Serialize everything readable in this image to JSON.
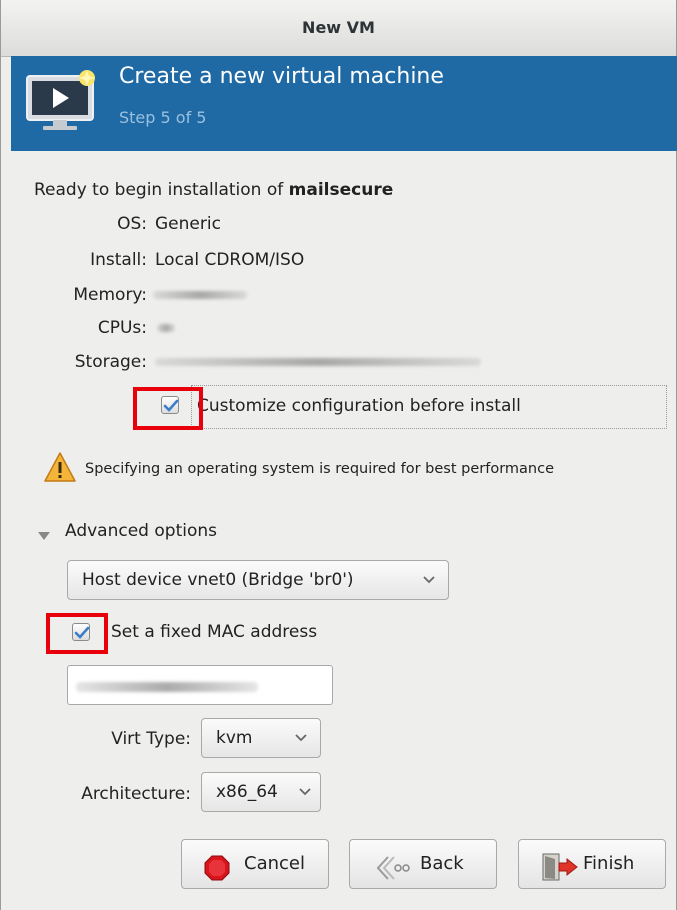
{
  "window": {
    "title": "New VM"
  },
  "header": {
    "title": "Create a new virtual machine",
    "step": "Step 5 of 5"
  },
  "summary": {
    "intro": "Ready to begin installation of ",
    "vm_name": "mailsecure",
    "os_label": "OS:",
    "os_value": "Generic",
    "install_label": "Install:",
    "install_value": "Local CDROM/ISO",
    "memory_label": "Memory:",
    "cpus_label": "CPUs:",
    "storage_label": "Storage:"
  },
  "customize": {
    "label": "Customize configuration before install",
    "checked": true
  },
  "warning": {
    "text": "Specifying an operating system is required for best performance"
  },
  "advanced": {
    "label": "Advanced options",
    "network": "Host device vnet0 (Bridge 'br0')",
    "fixed_mac_label": "Set a fixed MAC address",
    "fixed_mac_checked": true,
    "virt_type_label": "Virt Type:",
    "virt_type_value": "kvm",
    "arch_label": "Architecture:",
    "arch_value": "x86_64"
  },
  "buttons": {
    "cancel": "Cancel",
    "back": "Back",
    "finish": "Finish"
  },
  "colors": {
    "banner": "#1f6aa5",
    "highlight": "#e8000b"
  }
}
